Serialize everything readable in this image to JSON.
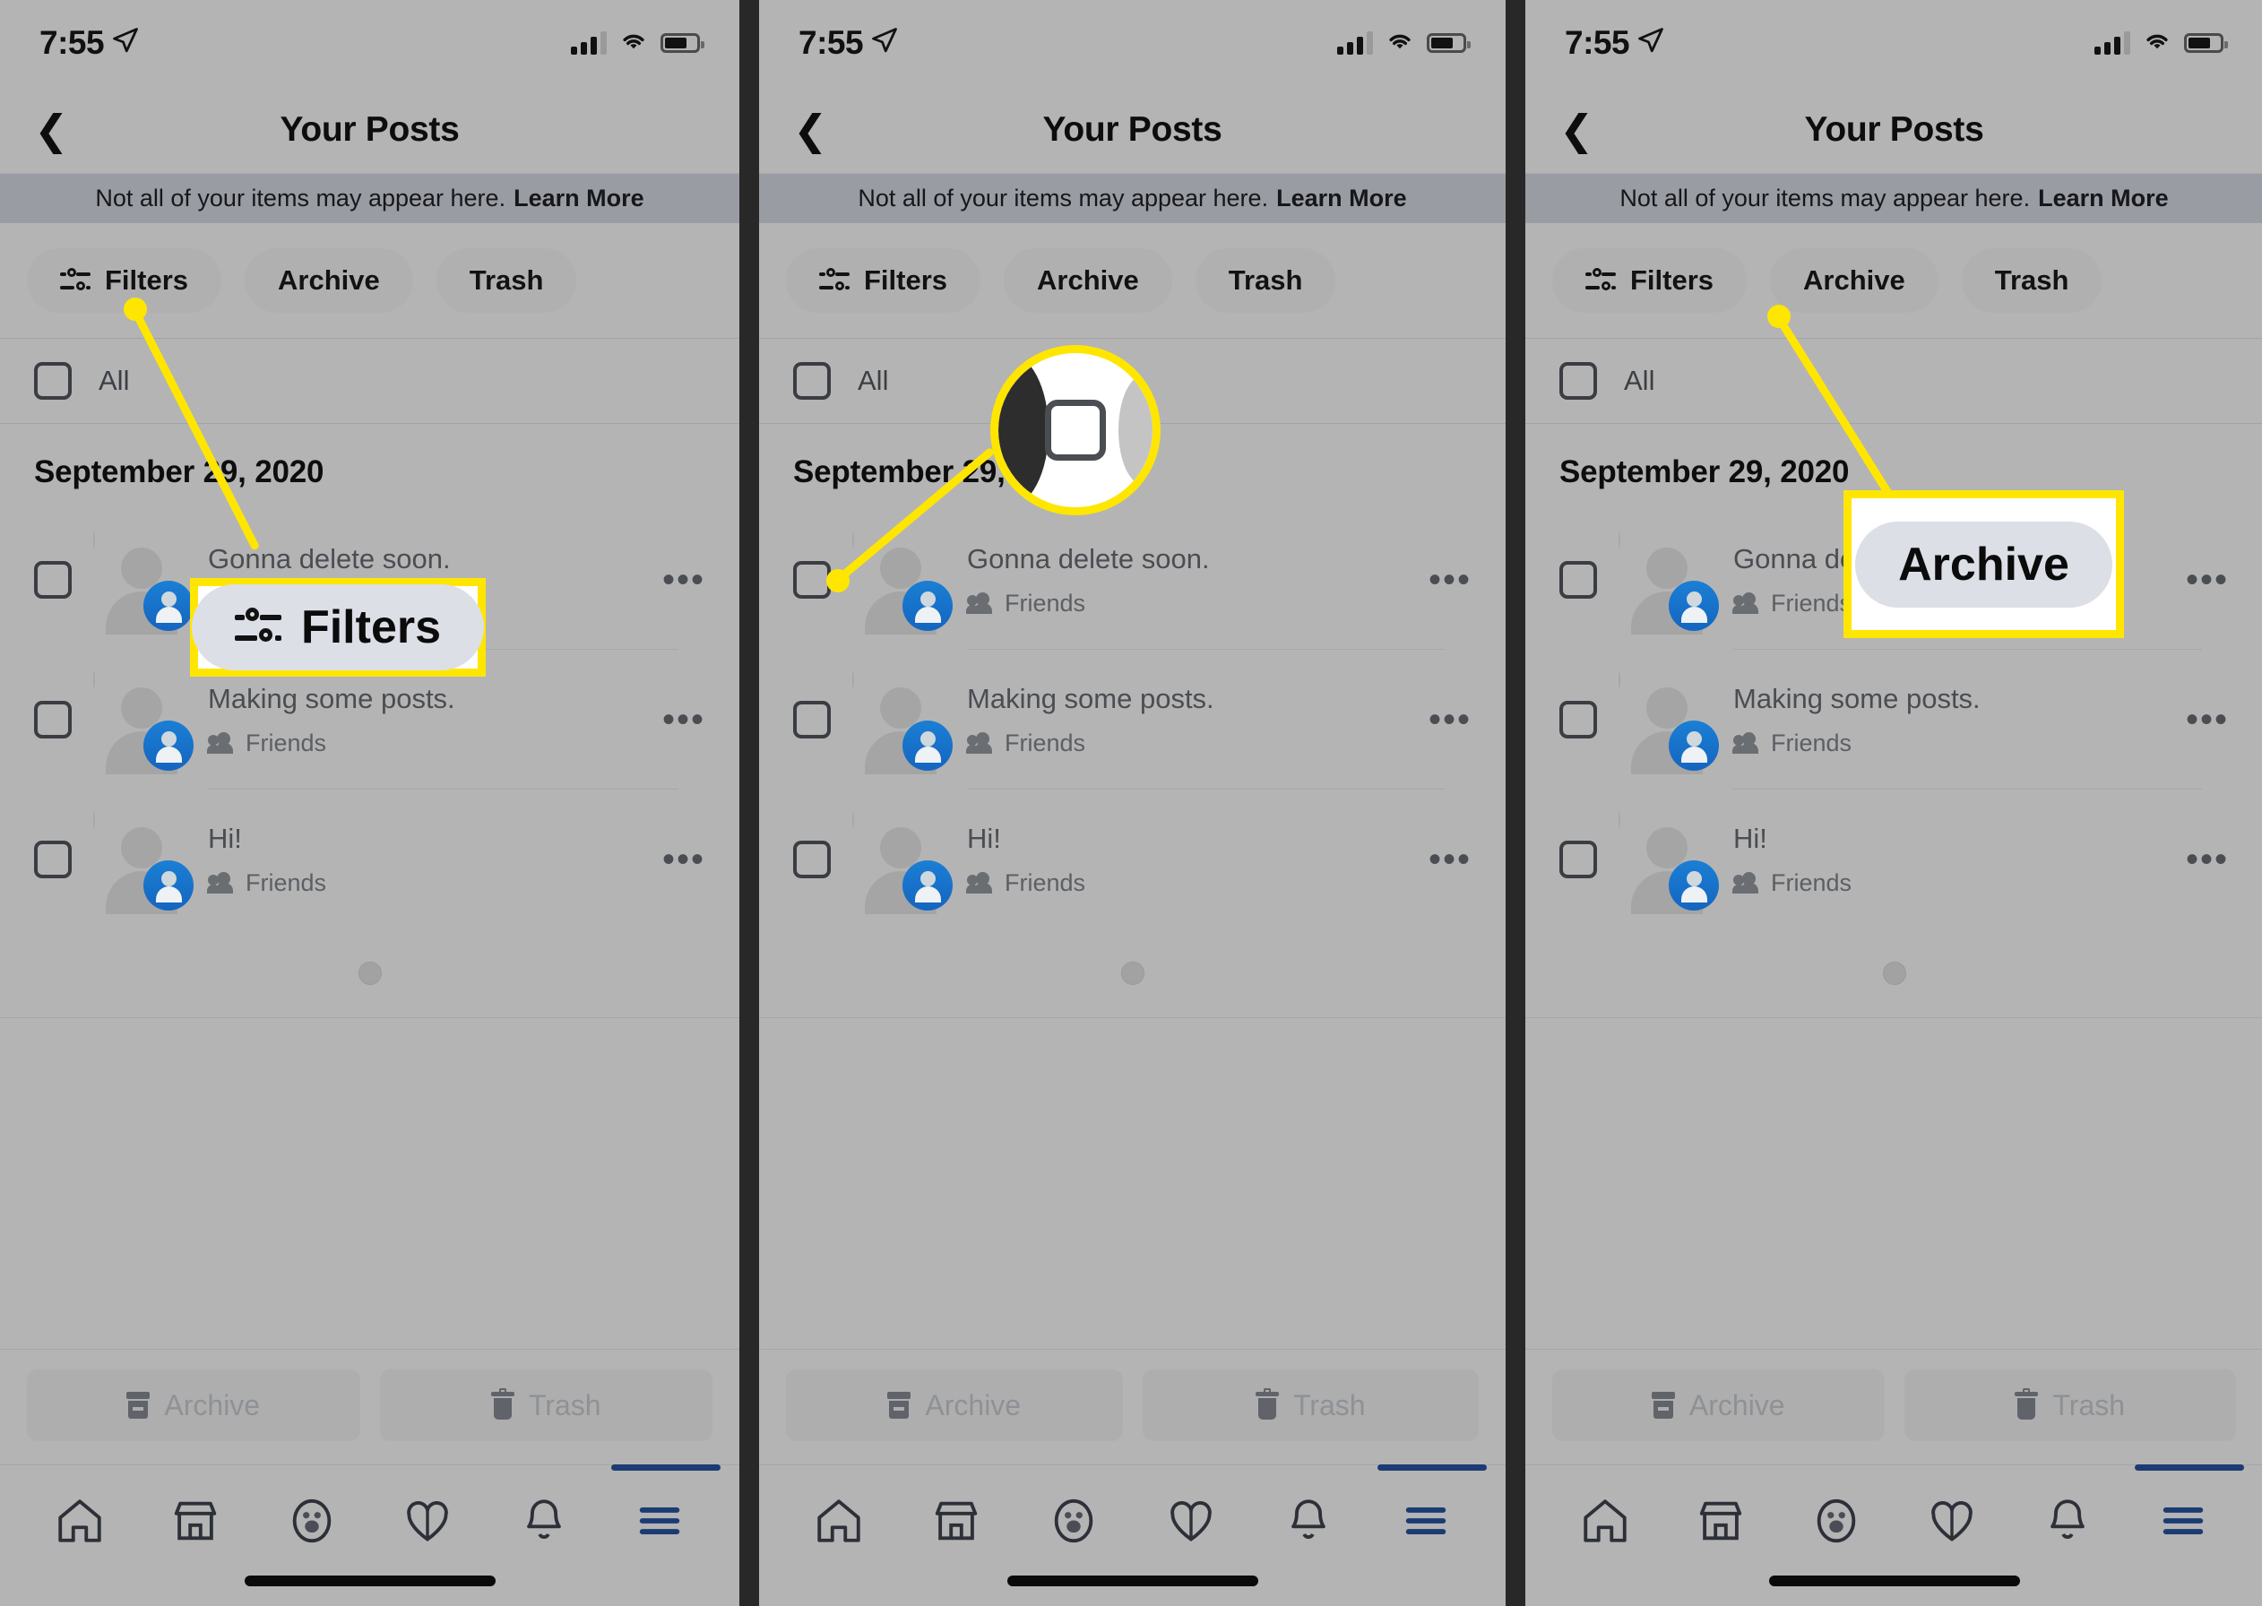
{
  "meta": {
    "app": "Facebook mobile — Your Posts (Activity Log)",
    "accent_yellow": "#ffe600",
    "bg_gray": "#b4b4b4",
    "notice_bg": "#9a9ca3",
    "badge_blue": "#1565c0",
    "nav_indicator_blue": "#1b3b73"
  },
  "status_bar": {
    "time": "7:55",
    "location_icon": "location-arrow-icon",
    "signal_icon": "cellular-signal-icon",
    "wifi_icon": "wifi-icon",
    "battery_icon": "battery-icon"
  },
  "nav": {
    "back_icon": "back-chevron-icon",
    "title": "Your Posts"
  },
  "notice": {
    "text": "Not all of your items may appear here.",
    "link": "Learn More"
  },
  "filter_pills": [
    {
      "label": "Filters",
      "icon": "filters-sliders-icon"
    },
    {
      "label": "Archive",
      "icon": ""
    },
    {
      "label": "Trash",
      "icon": ""
    }
  ],
  "select_all": {
    "label": "All",
    "checked": false
  },
  "date_header": "September 29, 2020",
  "posts": [
    {
      "text": "Gonna delete soon.",
      "audience": "Friends",
      "checked": false,
      "menu_icon": "more-options-icon",
      "avatar_icon": "default-avatar-icon",
      "badge_icon": "profile-badge-icon"
    },
    {
      "text": "Making some posts.",
      "audience": "Friends",
      "checked": false,
      "menu_icon": "more-options-icon",
      "avatar_icon": "default-avatar-icon",
      "badge_icon": "profile-badge-icon"
    },
    {
      "text": "Hi!",
      "audience": "Friends",
      "checked": false,
      "menu_icon": "more-options-icon",
      "avatar_icon": "default-avatar-icon",
      "badge_icon": "profile-badge-icon"
    }
  ],
  "loading_indicator": "loading-dot",
  "actions": [
    {
      "label": "Archive",
      "icon": "archive-box-icon",
      "disabled": true
    },
    {
      "label": "Trash",
      "icon": "trash-can-icon",
      "disabled": true
    }
  ],
  "tab_bar": [
    {
      "name": "home-icon"
    },
    {
      "name": "marketplace-icon"
    },
    {
      "name": "groups-icon"
    },
    {
      "name": "watch-heart-icon"
    },
    {
      "name": "notifications-bell-icon"
    },
    {
      "name": "menu-hamburger-icon",
      "selected": true
    }
  ],
  "home_indicator": "home-indicator-bar",
  "annotations": {
    "panel1": {
      "type": "callout-box",
      "target": "Filters pill",
      "callout_label": "Filters",
      "callout_icon": "filters-sliders-icon"
    },
    "panel2": {
      "type": "circular-magnifier",
      "target": "post row checkbox",
      "magnified_element": "checkbox-unchecked"
    },
    "panel3": {
      "type": "callout-box",
      "target": "Archive pill",
      "callout_label": "Archive"
    }
  }
}
